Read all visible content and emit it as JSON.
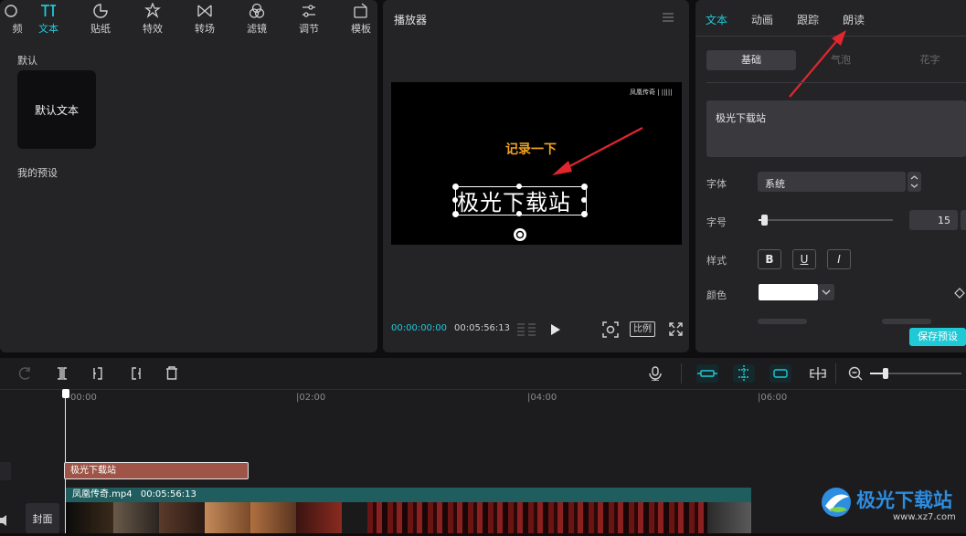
{
  "toolbar": {
    "partial_left_label": "频",
    "items": [
      {
        "label": "文本",
        "icon": "text-icon",
        "active": true
      },
      {
        "label": "贴纸",
        "icon": "sticker-icon"
      },
      {
        "label": "特效",
        "icon": "effects-icon"
      },
      {
        "label": "转场",
        "icon": "transition-icon"
      },
      {
        "label": "滤镜",
        "icon": "filter-icon"
      },
      {
        "label": "调节",
        "icon": "adjust-icon"
      },
      {
        "label": "模板",
        "icon": "template-icon"
      }
    ]
  },
  "library": {
    "default_section": "默认",
    "default_card": "默认文本",
    "my_presets": "我的预设"
  },
  "player": {
    "title": "播放器",
    "overlay_caption": "记录一下",
    "main_text": "极光下载站",
    "watermark": "凤凰传奇 | |||||",
    "current_time": "00:00:00:00",
    "total_time": "00:05:56:13",
    "ratio_button": "比例"
  },
  "inspector": {
    "tabs": [
      "文本",
      "动画",
      "跟踪",
      "朗读"
    ],
    "subtabs": [
      "基础",
      "气泡",
      "花字"
    ],
    "text_value": "极光下载站",
    "font_label": "字体",
    "font_value": "系统",
    "size_label": "字号",
    "size_value": "15",
    "size_slider_level": 0.05,
    "style_label": "样式",
    "style_buttons": [
      "B",
      "U",
      "I"
    ],
    "color_label": "颜色",
    "color_value": "#ffffff",
    "save_preset": "保存预设"
  },
  "timeline": {
    "ruler": [
      "00:00",
      "02:00",
      "04:00",
      "06:00"
    ],
    "text_clip": "极光下载站",
    "video_clip_name": "凤凰传奇.mp4",
    "video_clip_duration": "00:05:56:13",
    "cover_label": "封面",
    "zoom_level": 0.3
  },
  "watermark_logo": {
    "text": "极光下载站",
    "url": "www.xz7.com"
  },
  "colors": {
    "accent": "#20c9d6",
    "caption": "#f4a31d",
    "annotation_arrow": "#e0262e",
    "text_clip": "#9e5446",
    "video_clip": "#1f5d5e"
  }
}
